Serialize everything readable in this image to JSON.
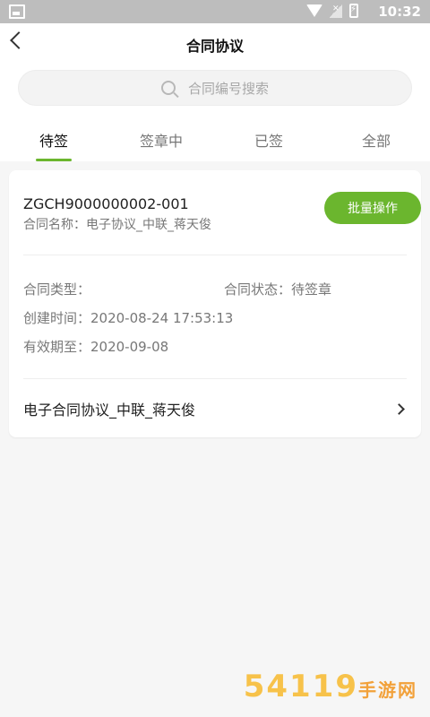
{
  "status_bar": {
    "time": "10:32"
  },
  "header": {
    "title": "合同协议"
  },
  "search": {
    "placeholder": "合同编号搜索"
  },
  "tabs": [
    {
      "label": "待签",
      "active": true
    },
    {
      "label": "签章中",
      "active": false
    },
    {
      "label": "已签",
      "active": false
    },
    {
      "label": "全部",
      "active": false
    }
  ],
  "contract": {
    "code": "ZGCH9000000002-001",
    "name_label": "合同名称：电子协议_中联_蒋天俊",
    "batch_button": "批量操作",
    "type_label": "合同类型：",
    "status_label": "合同状态：待签章",
    "created_label": "创建时间：2020-08-24 17:53:13",
    "valid_label": "有效期至：2020-09-08",
    "link_text": "电子合同协议_中联_蒋天俊"
  },
  "watermark": {
    "text": "54119",
    "suffix": "手游网"
  },
  "colors": {
    "accent": "#6bb62e"
  }
}
